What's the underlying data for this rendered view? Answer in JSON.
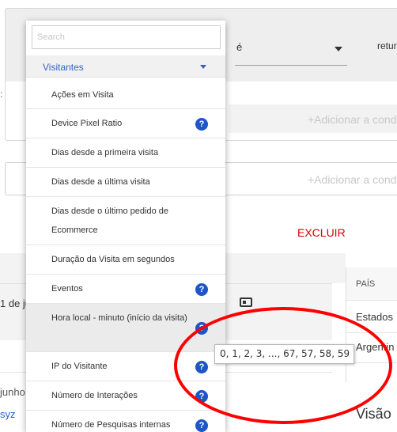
{
  "segment_editor": {
    "operator_value": "é",
    "value_fragment": "retur",
    "add_or_label": "+Adicionar a cond",
    "add_and_label": "+Adicionar a cond",
    "exclude_label": "EXCLUIR"
  },
  "background": {
    "date_fragment": "1 de ju",
    "junho_fragment": "junho",
    "link_fragment": "syz",
    "country_header": "PAÍS",
    "row1_country": "Estados",
    "row2_country": "Argentin",
    "section_title": "Visão"
  },
  "dropdown": {
    "search_placeholder": "Search",
    "group_label": "Visitantes",
    "items": [
      {
        "label": "Ações em Visita",
        "help": false
      },
      {
        "label": "Device Pixel Ratio",
        "help": true
      },
      {
        "label": "Dias desde a primeira visita",
        "help": false
      },
      {
        "label": "Dias desde a última visita",
        "help": false
      },
      {
        "label": "Dias desde o último pedido de Ecommerce",
        "help": false
      },
      {
        "label": "Duração da Visita em segundos",
        "help": false
      },
      {
        "label": "Eventos",
        "help": true
      },
      {
        "label": "Hora local - minuto (início da visita)",
        "help": true
      },
      {
        "label": "IP do Visitante",
        "help": true
      },
      {
        "label": "Número de Interações",
        "help": true
      },
      {
        "label": "Número de Pesquisas internas",
        "help": true
      }
    ],
    "help_glyph": "?"
  },
  "tooltip": {
    "text": "0, 1, 2, 3, ..., 67, 57, 58, 59"
  },
  "colors": {
    "accent_blue": "#1e55c8",
    "danger_red": "#d50000",
    "annotation_red": "#ff0000"
  }
}
